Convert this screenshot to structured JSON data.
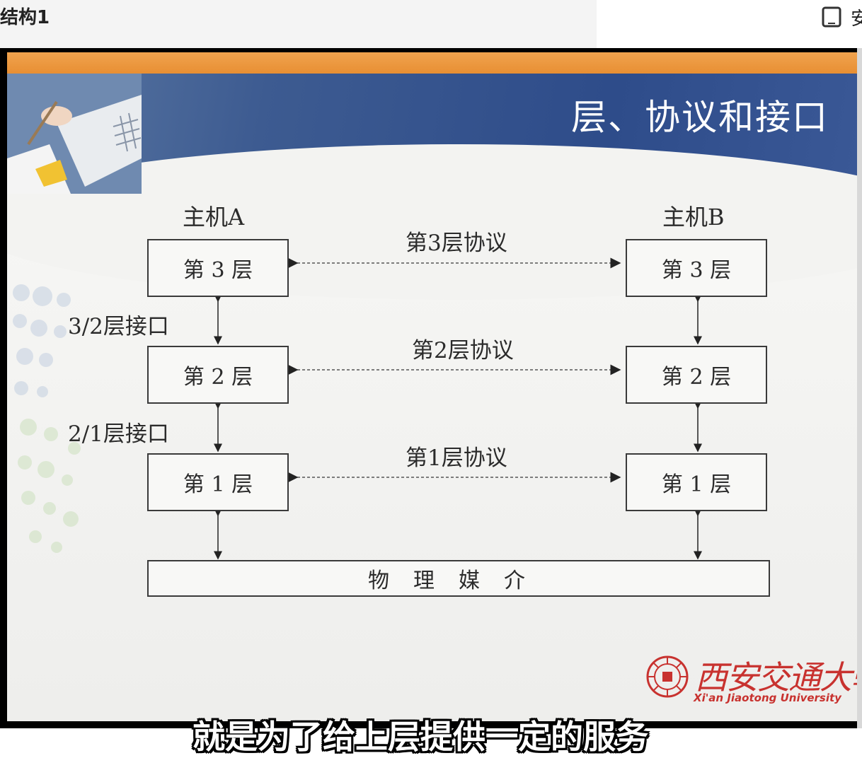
{
  "window": {
    "title": "结构1",
    "cut_text": "安"
  },
  "slide": {
    "heading": "层、协议和接口",
    "host_a": "主机A",
    "host_b": "主机B",
    "layers_a": [
      "第 3 层",
      "第 2 层",
      "第 1 层"
    ],
    "layers_b": [
      "第 3 层",
      "第 2 层",
      "第 1 层"
    ],
    "protocols": [
      "第3层协议",
      "第2层协议",
      "第1层协议"
    ],
    "interfaces": [
      "3/2层接口",
      "2/1层接口"
    ],
    "physical_medium": "物理媒介"
  },
  "logo": {
    "name_cn": "西安交通大學",
    "name_en": "Xi'an Jiaotong University"
  },
  "subtitle": "就是为了给上层提供一定的服务",
  "colors": {
    "banner_blue": "#2e4c8a",
    "orange_band": "#e88f33",
    "logo_red": "#c8322f"
  }
}
